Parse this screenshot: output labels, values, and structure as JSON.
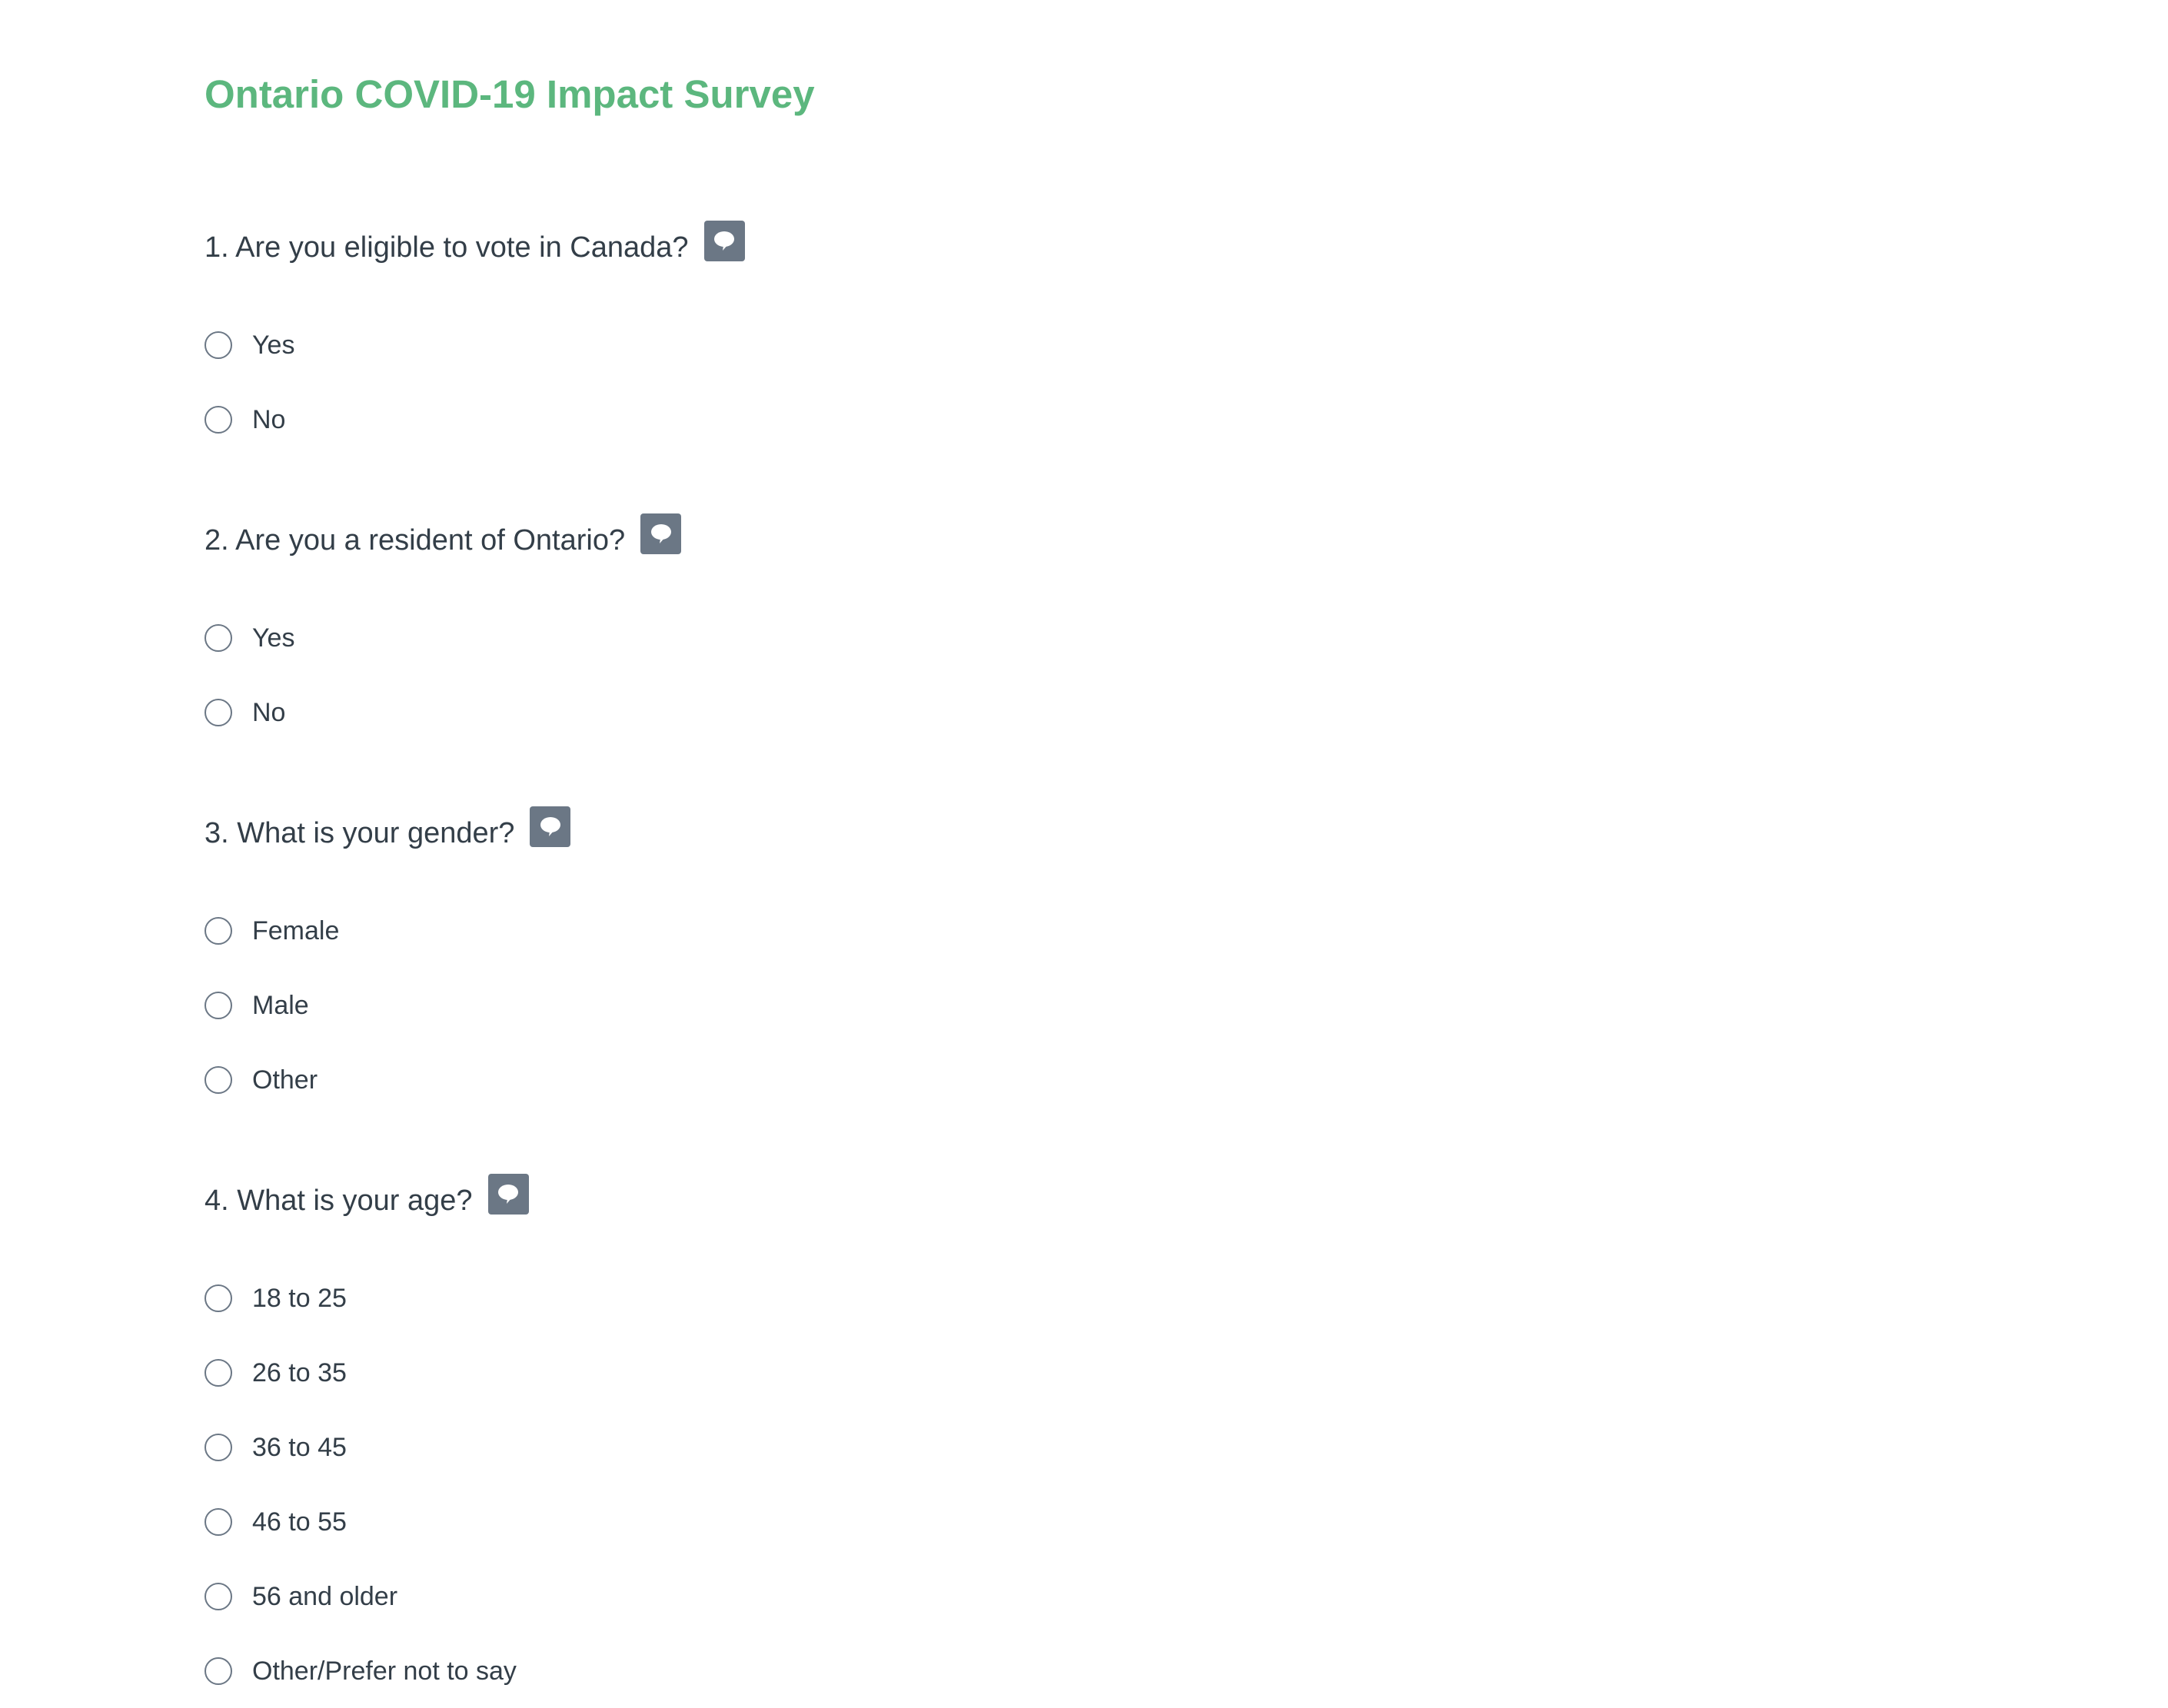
{
  "survey": {
    "title": "Ontario COVID-19 Impact Survey",
    "accent_color": "#5cb77e",
    "comment_icon": "speech-bubble-icon"
  },
  "questions": [
    {
      "text": "1. Are you eligible to vote in Canada?",
      "options": [
        "Yes",
        "No"
      ]
    },
    {
      "text": "2. Are you a resident of Ontario?",
      "options": [
        "Yes",
        "No"
      ]
    },
    {
      "text": "3. What is your gender?",
      "options": [
        "Female",
        "Male",
        "Other"
      ]
    },
    {
      "text": "4. What is your age?",
      "options": [
        "18 to 25",
        "26 to 35",
        "36 to 45",
        "46 to 55",
        "56 and older",
        "Other/Prefer not to say"
      ]
    }
  ]
}
